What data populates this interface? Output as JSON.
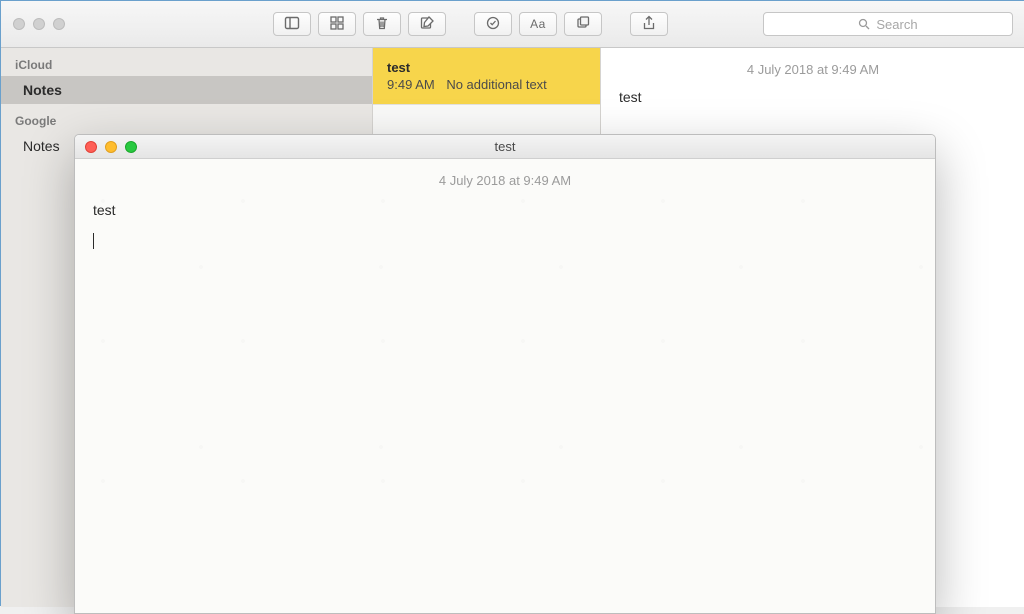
{
  "search": {
    "placeholder": "Search"
  },
  "sidebar": {
    "accounts": [
      {
        "name": "iCloud",
        "folders": [
          {
            "name": "Notes",
            "selected": true
          }
        ]
      },
      {
        "name": "Google",
        "folders": [
          {
            "name": "Notes",
            "selected": false
          }
        ]
      }
    ]
  },
  "note_list": {
    "items": [
      {
        "title": "test",
        "time": "9:49 AM",
        "preview": "No additional text",
        "selected": true
      }
    ]
  },
  "editor": {
    "date": "4 July 2018 at 9:49 AM",
    "body": "test"
  },
  "float_window": {
    "title": "test",
    "date": "4 July 2018 at 9:49 AM",
    "body": "test"
  },
  "toolbar": {
    "format_label": "Aa"
  },
  "icons": {
    "sidebar_toggle": "sidebar-toggle-icon",
    "gallery": "gallery-icon",
    "trash": "trash-icon",
    "compose": "compose-icon",
    "checklist": "checklist-icon",
    "format": "format-icon",
    "window": "window-icon",
    "share": "share-icon",
    "search": "search-icon"
  }
}
